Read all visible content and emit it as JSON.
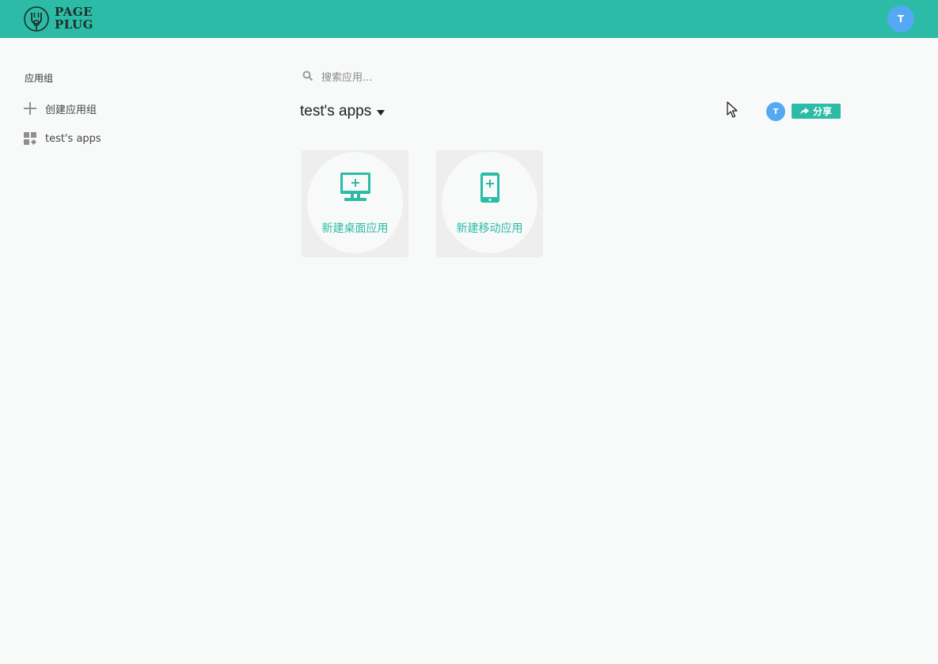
{
  "header": {
    "logo_line1": "PAGE",
    "logo_line2": "PLUG",
    "user_initial": "T"
  },
  "sidebar": {
    "title": "应用组",
    "items": [
      {
        "label": "创建应用组",
        "icon": "plus-icon"
      },
      {
        "label": "test's apps",
        "icon": "grid-icon"
      }
    ]
  },
  "main": {
    "search_placeholder": "搜索应用...",
    "workspace_title": "test's apps",
    "member_initial": "T",
    "share_label": "分享",
    "cards": [
      {
        "label": "新建桌面应用",
        "icon": "desktop-plus-icon"
      },
      {
        "label": "新建移动应用",
        "icon": "mobile-plus-icon"
      }
    ]
  },
  "colors": {
    "brand": "#2cbba6",
    "avatar": "#54a9f4",
    "background": "#f8f9f9"
  }
}
